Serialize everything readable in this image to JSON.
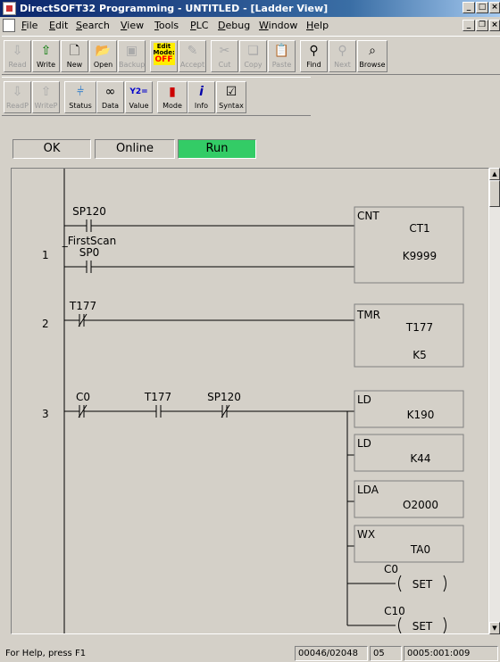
{
  "window": {
    "title": "DirectSOFT32 Programming - UNTITLED - [Ladder View]"
  },
  "menubar": {
    "items": [
      "File",
      "Edit",
      "Search",
      "View",
      "Tools",
      "PLC",
      "Debug",
      "Window",
      "Help"
    ]
  },
  "toolbar1": {
    "read": "Read",
    "write": "Write",
    "new": "New",
    "open": "Open",
    "backup": "Backup",
    "edit_mode_line1": "Edit",
    "edit_mode_line2": "Mode:",
    "edit_mode_state": "OFF",
    "accept": "Accept",
    "cut": "Cut",
    "copy": "Copy",
    "paste": "Paste",
    "find": "Find",
    "next": "Next",
    "browse": "Browse"
  },
  "toolbar2": {
    "readp": "ReadP",
    "writep": "WriteP",
    "status": "Status",
    "data": "Data",
    "value": "Value",
    "mode": "Mode",
    "info": "Info",
    "syntax": "Syntax"
  },
  "plc_status": {
    "ok": "OK",
    "online": "Online",
    "run": "Run",
    "run_color": "#33cc66"
  },
  "ladder": {
    "rungs": [
      {
        "number": "1",
        "contacts": [
          {
            "address": "SP120",
            "type": "NO"
          },
          {
            "label": "_FirstScan",
            "address": "SP0",
            "type": "NO"
          }
        ],
        "box": {
          "type": "CNT",
          "name": "CT1",
          "preset": "K9999"
        }
      },
      {
        "number": "2",
        "contacts": [
          {
            "address": "T177",
            "type": "NC"
          }
        ],
        "box": {
          "type": "TMR",
          "name": "T177",
          "preset": "K5"
        }
      },
      {
        "number": "3",
        "contacts": [
          {
            "address": "C0",
            "type": "NC"
          },
          {
            "address": "T177",
            "type": "NO"
          },
          {
            "address": "SP120",
            "type": "NC"
          }
        ],
        "outputs": [
          {
            "instr": "LD",
            "operand": "K190"
          },
          {
            "instr": "LD",
            "operand": "K44"
          },
          {
            "instr": "LDA",
            "operand": "O2000"
          },
          {
            "instr": "WX",
            "operand": "TA0"
          }
        ],
        "coils": [
          {
            "address": "C0",
            "action": "SET"
          },
          {
            "address": "C10",
            "action": "SET"
          }
        ]
      }
    ]
  },
  "statusbar": {
    "help": "For Help, press F1",
    "memory": "00046/02048",
    "col": "05",
    "position": "0005:001:009"
  }
}
